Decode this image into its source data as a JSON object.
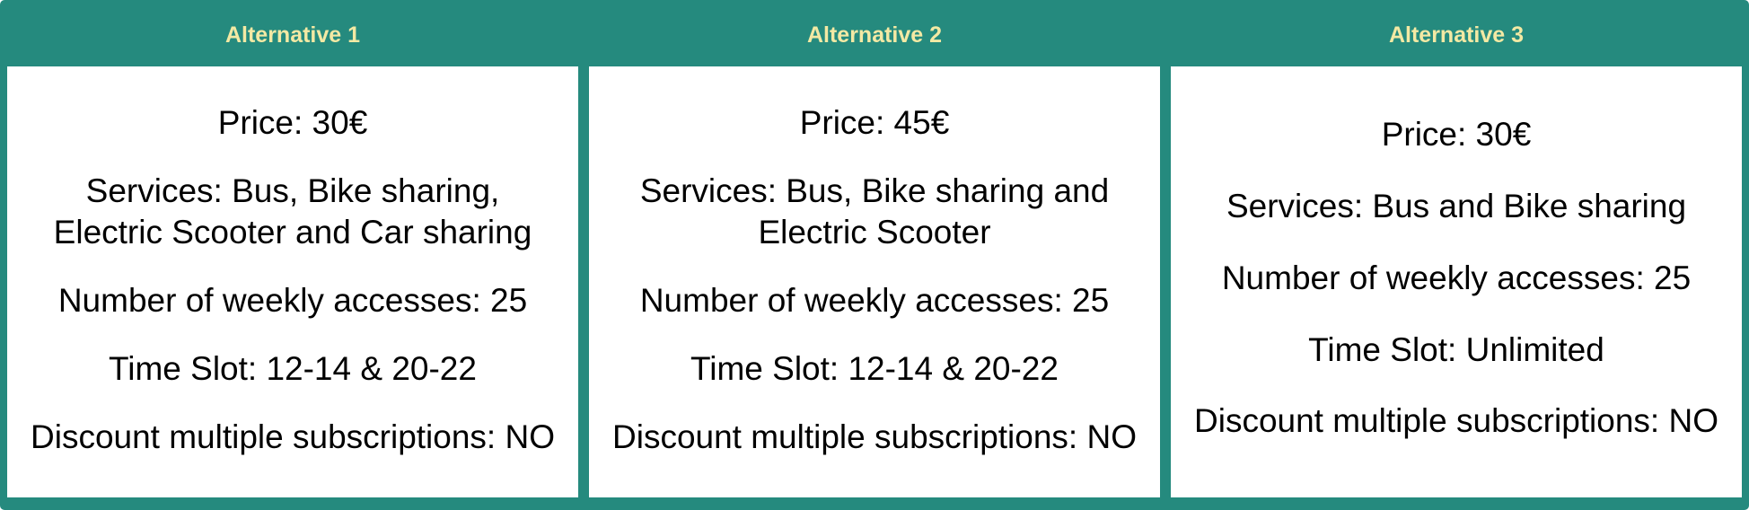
{
  "columns": [
    {
      "header": "Alternative 1",
      "price": "Price: 30€",
      "services": "Services: Bus, Bike sharing,\nElectric Scooter and Car sharing",
      "weekly_accesses": "Number of weekly accesses: 25",
      "time_slot": "Time Slot: 12-14 & 20-22",
      "discount": "Discount multiple subscriptions: NO"
    },
    {
      "header": "Alternative 2",
      "price": "Price: 45€",
      "services": "Services: Bus, Bike sharing and\nElectric Scooter",
      "weekly_accesses": "Number of weekly accesses: 25",
      "time_slot": "Time Slot: 12-14 & 20-22",
      "discount": "Discount multiple subscriptions: NO"
    },
    {
      "header": "Alternative 3",
      "price": "Price: 30€",
      "services": "Services: Bus and Bike sharing",
      "weekly_accesses": "Number of weekly accesses: 25",
      "time_slot": "Time Slot: Unlimited",
      "discount": "Discount multiple subscriptions: NO"
    }
  ],
  "colors": {
    "frame": "#258A7E",
    "header_text": "#F3E9A4",
    "cell_background": "#FFFFFF",
    "cell_text": "#000000"
  }
}
